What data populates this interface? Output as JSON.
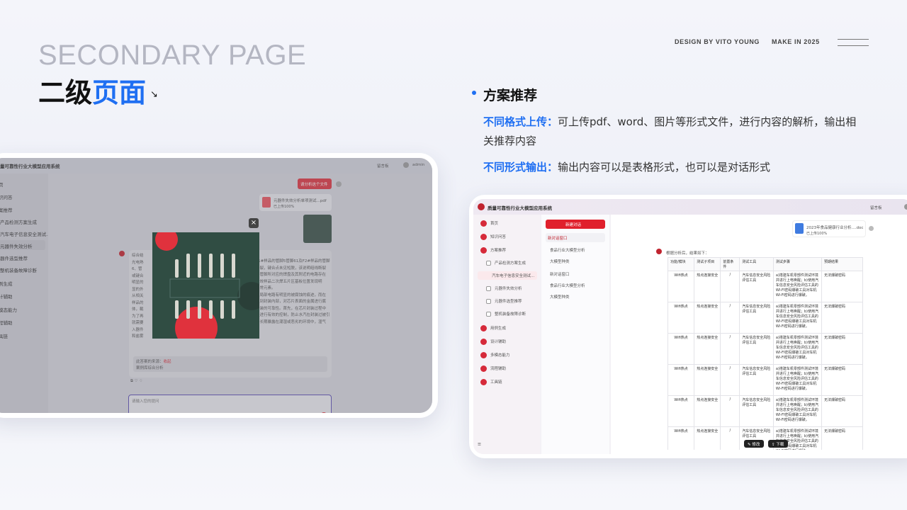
{
  "header": {
    "title_en": "SECONDARY PAGE",
    "title_cn_black": "二级",
    "title_cn_blue": "页面",
    "arrow": "↘",
    "design_by": "DESIGN BY VITO YOUNG",
    "make_in": "MAKE IN 2025"
  },
  "solution": {
    "title": "方案推荐",
    "line1_highlight": "不同格式上传：",
    "line1_text": "可上传pdf、word、图片等形式文件，进行内容的解析，输出相关推荐内容",
    "line2_highlight": "不同形式输出：",
    "line2_text": "输出内容可以是表格形式，也可以是对话形式"
  },
  "left_app": {
    "app_title": "量可靠性行业大模型应用系统",
    "header_right": [
      "留言板",
      "admin"
    ],
    "nav": [
      "页",
      "识问答",
      "案推荐",
      "产品检测方案生成",
      "汽车电子信息安全测试...",
      "元器件失效分析",
      "器件选型推荐",
      "整机装备故障诊断",
      "例生成",
      "计辅助",
      "模态能力",
      "程辅助",
      "具链"
    ],
    "request_button": "请分析这个文件",
    "file_name": "元器件失效分析单项测试...pdf",
    "file_status": "已上传100%",
    "answer_lines": [
      "综合结",
      "光电熟",
      "6、管",
      "或键合",
      "明显的",
      "显的外",
      "从相关",
      "样品的",
      "体，截",
      "为了再",
      "就需要",
      "入器件",
      "和盐雾"
    ],
    "answer_right_lines": [
      "样品F1#样品的管脚5管脚61及F2#样品的管脚",
      "显的断裂，键合点未见短脱，该说明组线断裂",
      "现开路管脚所对应的焊盘及其附近的电路存在",
      "熟。失效样品二次焊五片区基板位置发现明",
      "发现异常元素。",
      "焊盘和局部电路有明显的被腐蚀的痕迹，而在",
      "质进入到封装内部，对芯片表面的金属进行腐",
      "芯片封装的可靠性。首先，在芯片封装过程中",
      "汽车盖进行有效的控制，防止水汽在封装过被引",
      "让器件长期暴露在潮湿或恶劣的环境中，湿气"
    ],
    "source_label": "此答案的来源：",
    "source_toggle": "收起",
    "source_item": "案例库综合分析",
    "input_placeholder": "请输入您的提问",
    "close_icon": "×"
  },
  "right_app": {
    "app_title": "质量可靠性行业大模型应用系统",
    "header_right": [
      "留言板"
    ],
    "nav": [
      "首页",
      "知识问答",
      "方案推荐",
      "产品检测方案生成",
      "汽车电子信息安全测试...",
      "元器件失效分析",
      "元器件选型推荐",
      "整机装备故障诊断",
      "用例生成",
      "设计辅助",
      "多模态能力",
      "流程辅助",
      "工具链"
    ],
    "new_chat": "新建对话",
    "conversations": [
      "新对话窗口",
      "食品行业大模型分析",
      "大模型种类",
      "新对话窗口",
      "食品行业大模型分析",
      "大模型种类"
    ],
    "file_name": "2023年食品健康行业分析....doc",
    "file_status": "已上传100%",
    "reply_intro": "根据分析后，结果如下：",
    "table_headers": [
      "功能/模块",
      "测试子项目",
      "前置条件",
      "测试工具",
      "测试步骤",
      "预期结果"
    ],
    "table_rows": [
      [
        "Wifi热点",
        "热点连接安全",
        "/",
        "汽车信息安全风险评估工具",
        "a)搭建车机零部件测试环境并进行上电唤醒；b)使用汽车信息安全风险评估工具的WI-FI密码爆破工具对车机Wi-Fi密码进行爆破。",
        "无法爆破密码"
      ],
      [
        "Wifi热点",
        "热点连接安全",
        "/",
        "汽车信息安全风险评估工具",
        "a)搭建车机零部件测试环境并进行上电唤醒；b)使用汽车信息安全风险评估工具的WI-FI密码爆破工具对车机Wi-Fi密码进行爆破。",
        "无法爆破密码"
      ],
      [
        "Wifi热点",
        "热点连接安全",
        "/",
        "汽车信息安全风险评估工具",
        "a)搭建车机零部件测试环境并进行上电唤醒；b)使用汽车信息安全风险评估工具的WI-FI密码爆破工具对车机Wi-Fi密码进行爆破。",
        "无法爆破密码"
      ],
      [
        "Wifi热点",
        "热点连接安全",
        "/",
        "汽车信息安全风险评估工具",
        "a)搭建车机零部件测试环境并进行上电唤醒；b)使用汽车信息安全风险评估工具的WI-FI密码爆破工具对车机Wi-Fi密码进行爆破。",
        "无法爆破密码"
      ],
      [
        "Wifi热点",
        "热点连接安全",
        "/",
        "汽车信息安全风险评估工具",
        "a)搭建车机零部件测试环境并进行上电唤醒；b)使用汽车信息安全风险评估工具的WI-FI密码爆破工具对车机Wi-Fi密码进行爆破。",
        "无法爆破密码"
      ],
      [
        "Wifi热点",
        "热点连接安全",
        "/",
        "汽车信息安全风险评估工具",
        "a)搭建车机零部件测试环境并进行上电唤醒；b)使用汽车信息安全风险评估工具的WI-FI密码爆破工具对车机Wi-Fi密码进行爆破。",
        "无法爆破密码"
      ]
    ],
    "edit_button": "修改",
    "download_button": "下载"
  },
  "colors": {
    "accent": "#1f6ff2",
    "brand_red": "#d62a3a"
  }
}
